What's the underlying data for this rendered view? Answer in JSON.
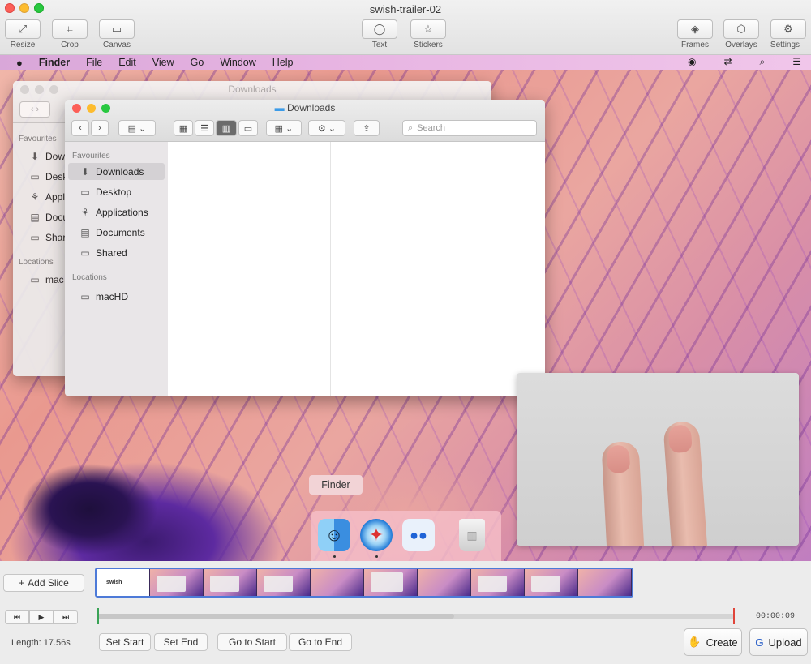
{
  "app": {
    "title": "swish-trailer-02",
    "toolbar_left": [
      {
        "label": "Resize",
        "icon": "resize-icon",
        "glyph": "⤢"
      },
      {
        "label": "Crop",
        "icon": "crop-icon",
        "glyph": "⌗"
      },
      {
        "label": "Canvas",
        "icon": "canvas-icon",
        "glyph": "▭"
      }
    ],
    "toolbar_center": [
      {
        "label": "Text",
        "icon": "speech-bubble-icon",
        "glyph": "◯"
      },
      {
        "label": "Stickers",
        "icon": "star-icon",
        "glyph": "☆"
      }
    ],
    "toolbar_right": [
      {
        "label": "Frames",
        "icon": "frames-icon",
        "glyph": "◈"
      },
      {
        "label": "Overlays",
        "icon": "overlays-icon",
        "glyph": "⬡"
      },
      {
        "label": "Settings",
        "icon": "gear-icon",
        "glyph": "⚙"
      }
    ]
  },
  "mac_menubar": {
    "apple": "",
    "app_name": "Finder",
    "items": [
      "File",
      "Edit",
      "View",
      "Go",
      "Window",
      "Help"
    ]
  },
  "finder_back": {
    "title": "Downloads",
    "favourites_header": "Favourites",
    "items": [
      "Dow",
      "Desk",
      "Appl",
      "Docu",
      "Shar"
    ],
    "locations_header": "Locations",
    "locations": [
      "mac"
    ]
  },
  "finder_front": {
    "title": "Downloads",
    "search_placeholder": "Search",
    "favourites_header": "Favourites",
    "favourites": [
      {
        "label": "Downloads",
        "icon": "download-icon",
        "glyph": "⬇"
      },
      {
        "label": "Desktop",
        "icon": "desktop-icon",
        "glyph": "▭"
      },
      {
        "label": "Applications",
        "icon": "applications-icon",
        "glyph": "⚘"
      },
      {
        "label": "Documents",
        "icon": "documents-icon",
        "glyph": "▤"
      },
      {
        "label": "Shared",
        "icon": "shared-folder-icon",
        "glyph": "▭"
      }
    ],
    "locations_header": "Locations",
    "locations": [
      {
        "label": "macHD",
        "icon": "disk-icon",
        "glyph": "▭"
      }
    ]
  },
  "dock": {
    "tooltip": "Finder"
  },
  "editor": {
    "add_slice": "Add Slice",
    "first_thumb_label": "swish",
    "time": "00:00:09",
    "length": "Length: 17.56s",
    "set_start": "Set Start",
    "set_end": "Set End",
    "go_to_start": "Go to Start",
    "go_to_end": "Go to End",
    "create": "Create",
    "upload": "Upload"
  },
  "colors": {
    "accent": "#4d7ad8",
    "start_marker": "#3aa356",
    "end_marker": "#e0453a"
  }
}
